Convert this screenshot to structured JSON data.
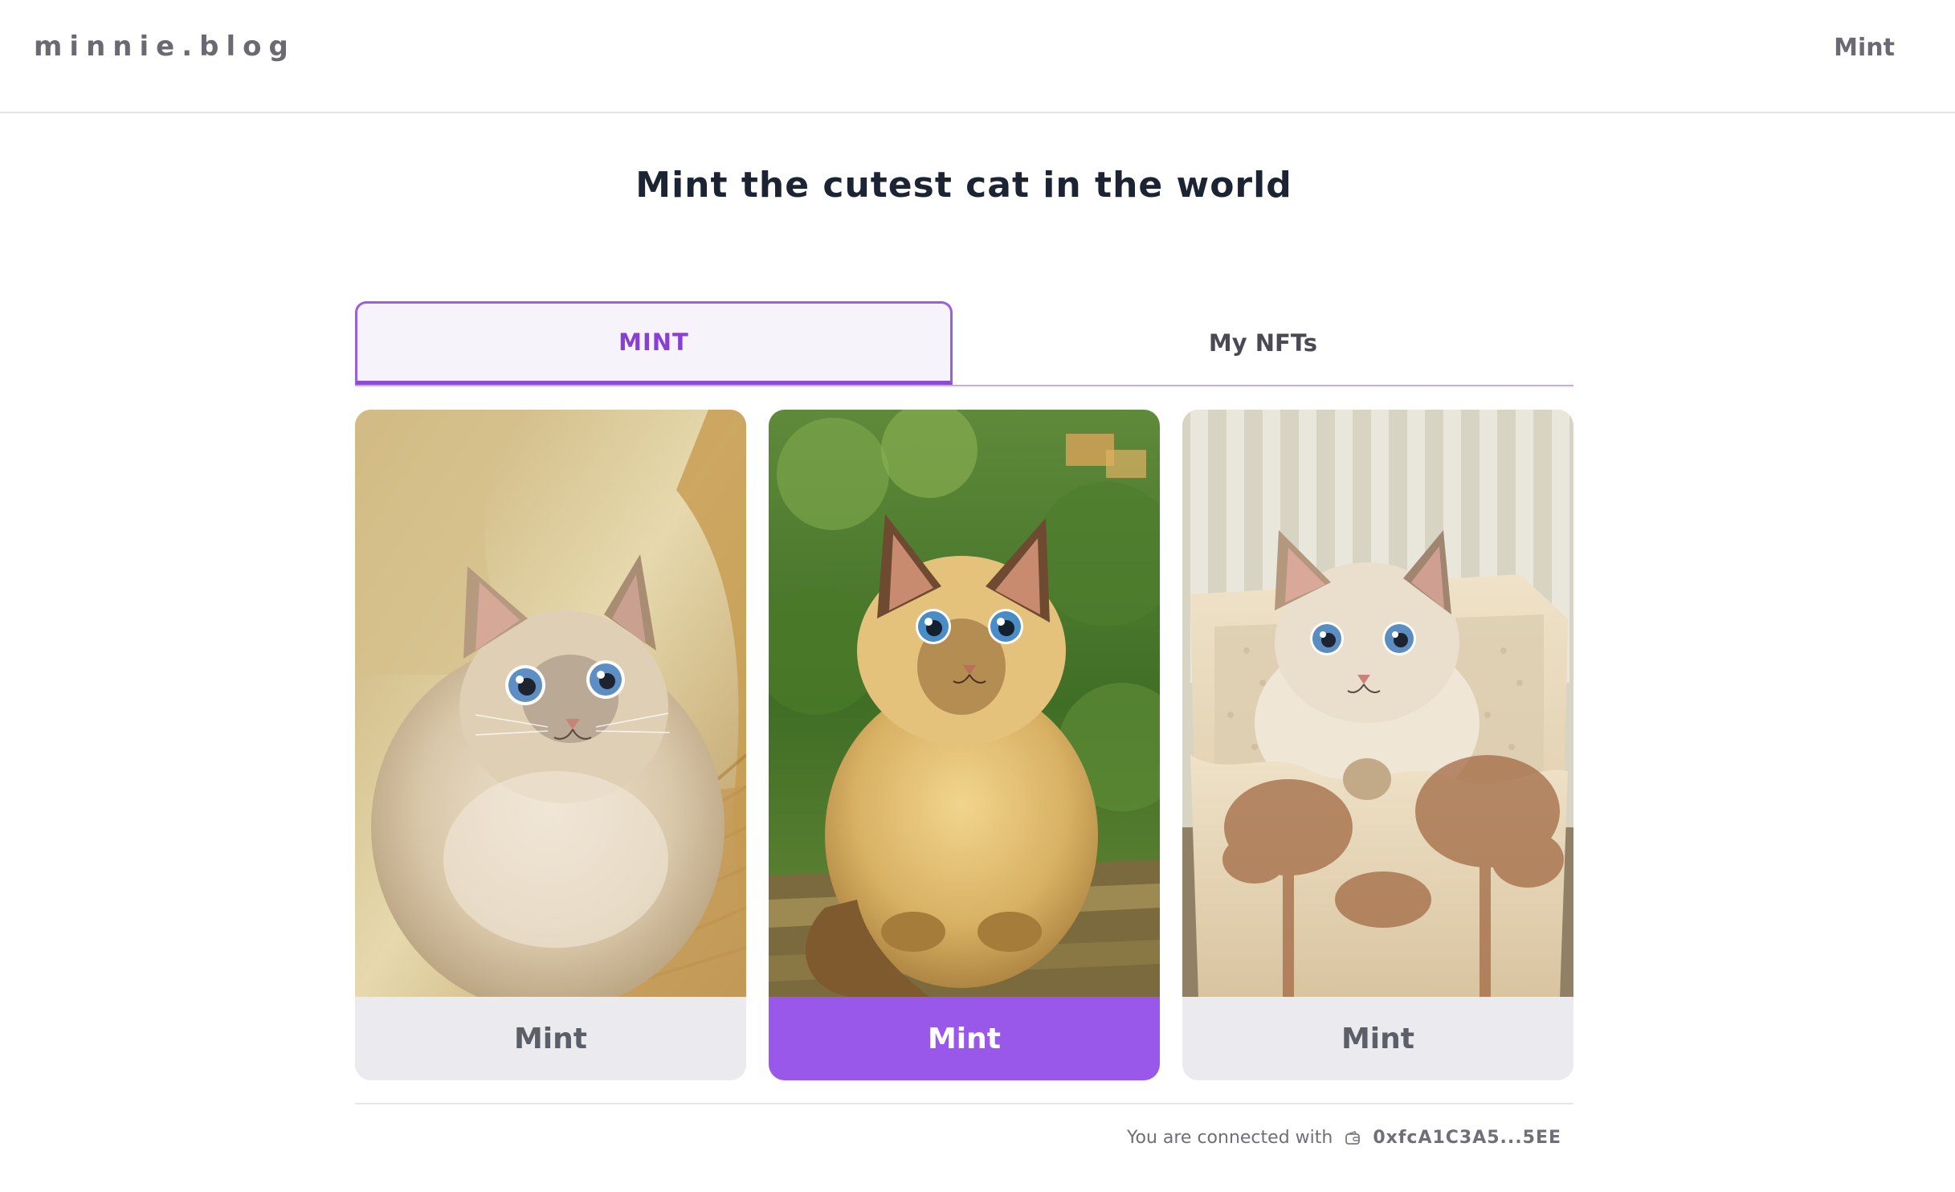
{
  "header": {
    "logo": "minnie.blog",
    "nav_mint": "Mint"
  },
  "main": {
    "title": "Mint the cutest cat in the world",
    "tabs": [
      {
        "label": "MINT",
        "active": true
      },
      {
        "label": "My NFTs",
        "active": false
      }
    ],
    "cards": [
      {
        "image": "cat-on-wicker-chair",
        "button_label": "Mint",
        "highlighted": false
      },
      {
        "image": "cat-on-wooden-bench-garden",
        "button_label": "Mint",
        "highlighted": true
      },
      {
        "image": "cat-in-paper-bag",
        "button_label": "Mint",
        "highlighted": false
      }
    ]
  },
  "footer": {
    "connected_text": "You are connected with",
    "wallet_icon": "wallet-icon",
    "address": "0xfcA1C3A5...5EE"
  },
  "colors": {
    "accent": "#9a58ea",
    "tab_active_text": "#8a3fd2",
    "button_grey": "#ebebef"
  }
}
